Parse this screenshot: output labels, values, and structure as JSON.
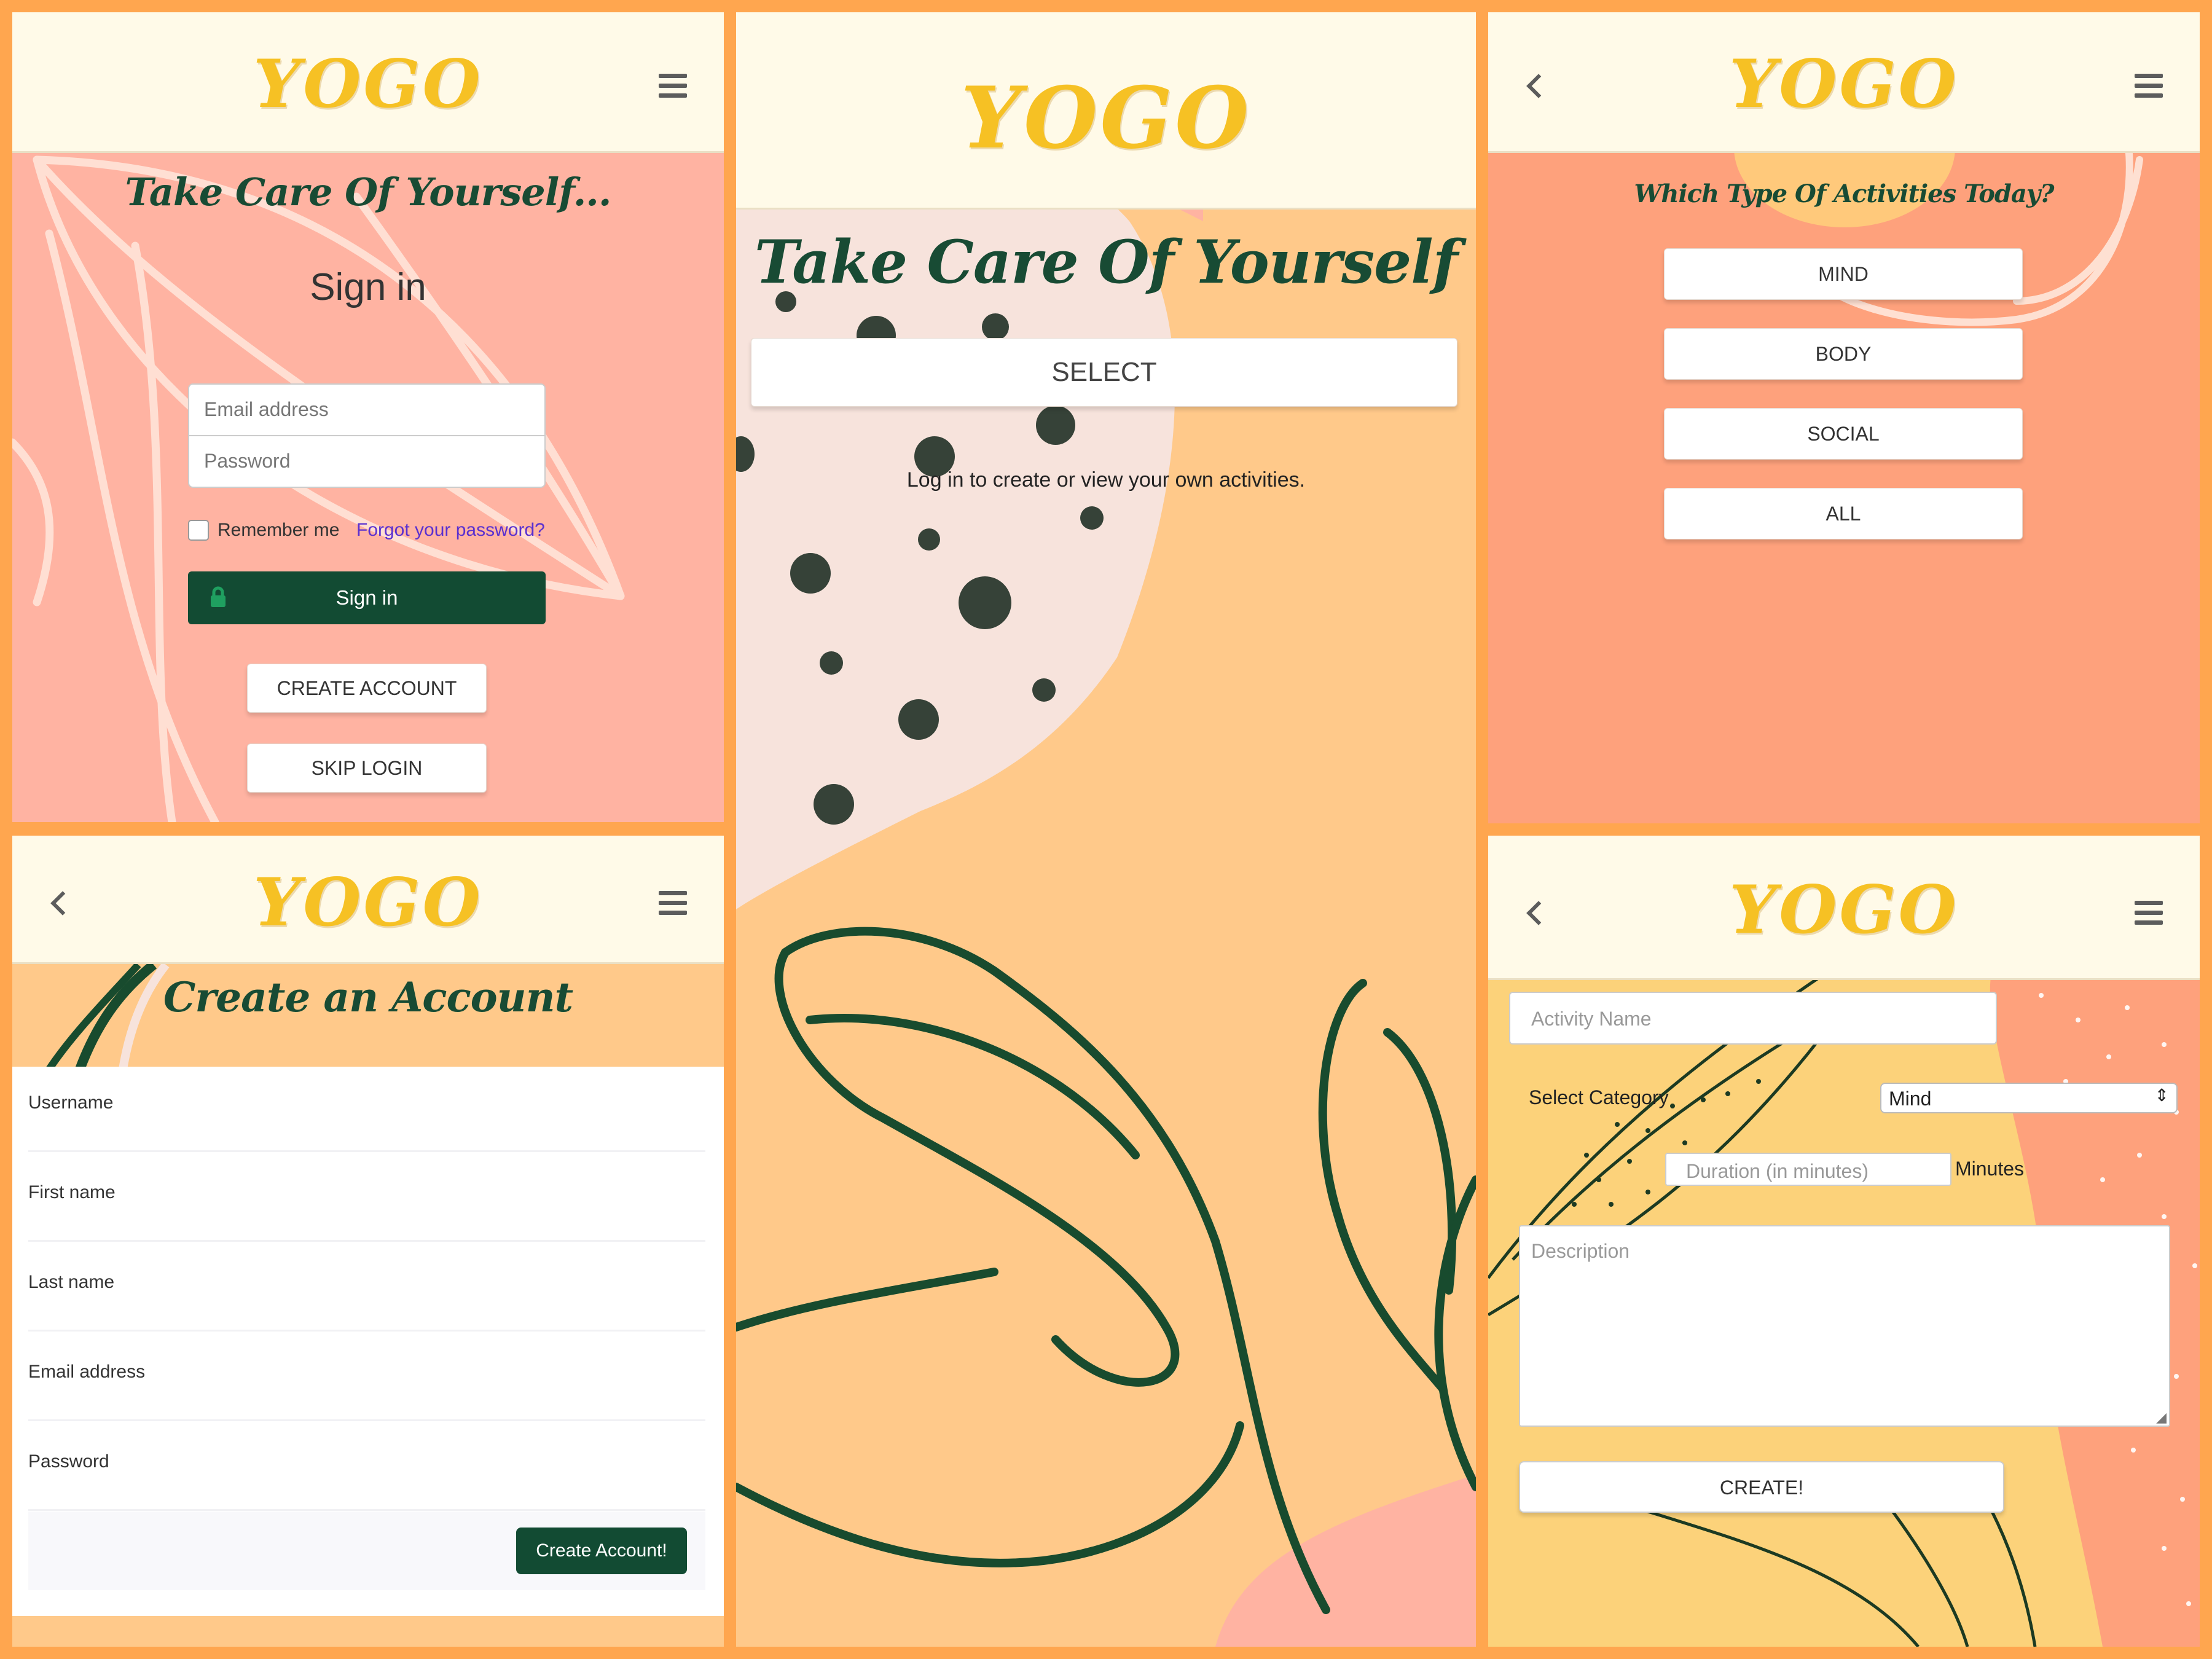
{
  "app": {
    "logo": "YOGO"
  },
  "signin": {
    "tagline": "Take Care Of Yourself...",
    "heading": "Sign in",
    "email_placeholder": "Email address",
    "password_placeholder": "Password",
    "remember_label": "Remember me",
    "forgot_link": "Forgot your password?",
    "signin_button": "Sign in",
    "create_account_button": "CREATE ACCOUNT",
    "skip_login_button": "SKIP LOGIN"
  },
  "home": {
    "tagline": "Take Care Of Yourself",
    "select_button": "SELECT",
    "login_prompt": "Log in to create or view your own activities."
  },
  "activities": {
    "question": "Which Type Of Activities Today?",
    "options": [
      "MIND",
      "BODY",
      "SOCIAL",
      "ALL"
    ]
  },
  "create_account": {
    "title": "Create an Account",
    "fields": [
      "Username",
      "First name",
      "Last name",
      "Email address",
      "Password"
    ],
    "submit_button": "Create Account!"
  },
  "create_activity": {
    "name_placeholder": "Activity Name",
    "category_label": "Select Category",
    "category_selected": "Mind",
    "duration_placeholder": "Duration (in minutes)",
    "duration_unit": "Minutes",
    "description_placeholder": "Description",
    "create_button": "CREATE!"
  },
  "colors": {
    "frame": "#ffa64f",
    "header_bg": "#fffae8",
    "logo": "#f6c124",
    "brand_green": "#124b33",
    "salmon": "#ffb3a2",
    "peach": "#ffc98a",
    "coral": "#fea17c",
    "link": "#5a30d0"
  },
  "icons": [
    "menu-icon",
    "back-icon",
    "lock-icon",
    "chevron-updown-icon"
  ]
}
